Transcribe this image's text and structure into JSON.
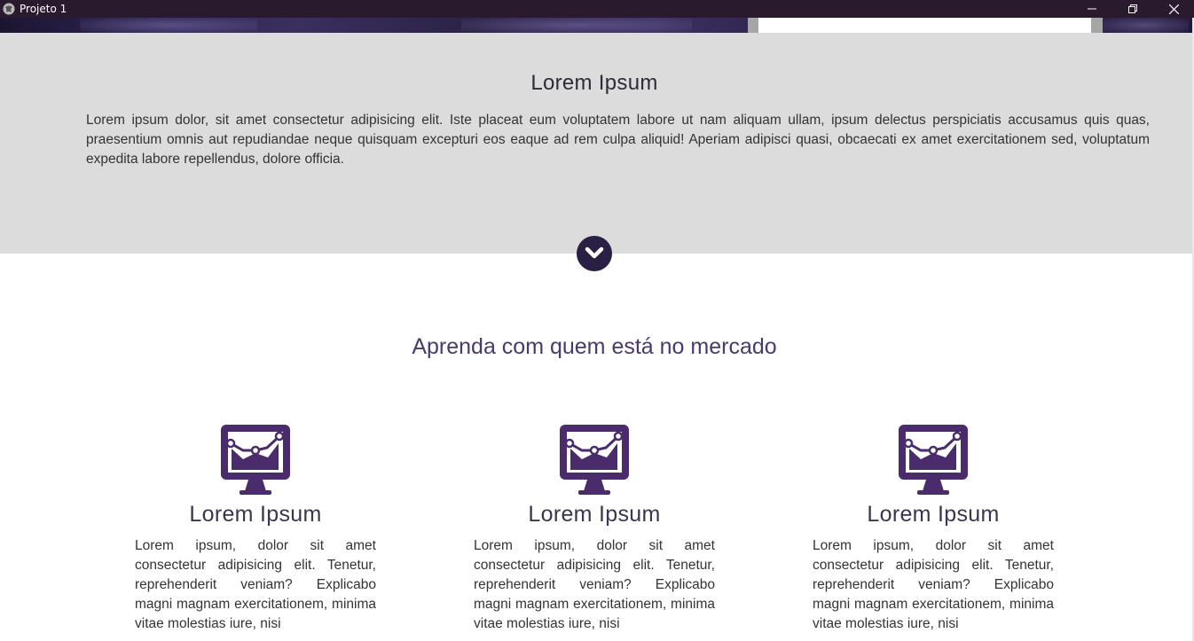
{
  "window": {
    "title": "Projeto 1",
    "controls": {
      "minimize": "—",
      "maximize": "❐",
      "close": "✕"
    }
  },
  "intro": {
    "title": "Lorem Ipsum",
    "text": "Lorem ipsum dolor, sit amet consectetur adipisicing elit. Iste placeat eum voluptatem labore ut nam aliquam ullam, ipsum delectus perspiciatis accusamus quis quas, praesentium omnis aut repudiandae neque quisquam excepturi eos eaque ad rem culpa aliquid! Aperiam adipisci quasi, obcaecati ex amet exercitationem sed, voluptatum expedita labore repellendus, dolore officia."
  },
  "section": {
    "heading": "Aprenda com quem está no mercado"
  },
  "features": [
    {
      "icon": "monitor-chart-icon",
      "title": "Lorem Ipsum",
      "text": "Lorem ipsum, dolor sit amet consectetur adipisicing elit. Tenetur, reprehenderit veniam? Explicabo magni magnam exercitationem, minima vitae molestias iure, nisi"
    },
    {
      "icon": "monitor-chart-icon",
      "title": "Lorem Ipsum",
      "text": "Lorem ipsum, dolor sit amet consectetur adipisicing elit. Tenetur, reprehenderit veniam? Explicabo magni magnam exercitationem, minima vitae molestias iure, nisi"
    },
    {
      "icon": "monitor-chart-icon",
      "title": "Lorem Ipsum",
      "text": "Lorem ipsum, dolor sit amet consectetur adipisicing elit. Tenetur, reprehenderit veniam? Explicabo magni magnam exercitationem, minima vitae molestias iure, nisi"
    }
  ],
  "colors": {
    "accent": "#4a2b6b",
    "dark": "#2a1f44",
    "grey_section": "#dcdcdc"
  }
}
